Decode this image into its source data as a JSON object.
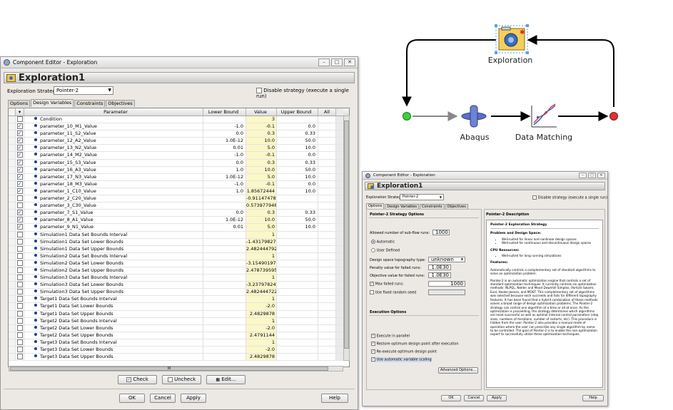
{
  "main": {
    "window_title": "Component Editor - Exploration",
    "header_title": "Exploration1",
    "strategy_label": "Exploration Strategy:",
    "strategy_value": "Pointer-2",
    "disable_label": "Disable strategy (execute a single run)",
    "tabs": [
      "Options",
      "Design Variables",
      "Constraints",
      "Objectives"
    ],
    "columns": [
      "Parameter",
      "Lower Bound",
      "Value",
      "Upper Bound",
      "All"
    ],
    "rows": [
      {
        "checked": false,
        "name": "Condition",
        "lower": "",
        "value": "3",
        "upper": ""
      },
      {
        "checked": true,
        "name": "parameter_10_M1_Value",
        "lower": "-1.0",
        "value": "-0.1",
        "upper": "0.0"
      },
      {
        "checked": true,
        "name": "parameter_11_S2_Value",
        "lower": "0.0",
        "value": "0.3",
        "upper": "0.33"
      },
      {
        "checked": true,
        "name": "parameter_12_A2_Value",
        "lower": "1.0E-12",
        "value": "10.0",
        "upper": "50.0"
      },
      {
        "checked": true,
        "name": "parameter_13_N2_Value",
        "lower": "0.01",
        "value": "5.0",
        "upper": "10.0"
      },
      {
        "checked": true,
        "name": "parameter_14_M2_Value",
        "lower": "-1.0",
        "value": "-0.1",
        "upper": "0.0"
      },
      {
        "checked": true,
        "name": "parameter_15_S3_Value",
        "lower": "0.0",
        "value": "0.3",
        "upper": "0.33"
      },
      {
        "checked": true,
        "name": "parameter_16_A3_Value",
        "lower": "1.0",
        "value": "10.0",
        "upper": "50.0"
      },
      {
        "checked": true,
        "name": "parameter_17_N3_Value",
        "lower": "1.0E-12",
        "value": "5.0",
        "upper": "10.0"
      },
      {
        "checked": true,
        "name": "parameter_18_M3_Value",
        "lower": "-1.0",
        "value": "-0.1",
        "upper": "0.0"
      },
      {
        "checked": true,
        "name": "parameter_1_C10_Value",
        "lower": "1.0",
        "value": "1.85672444",
        "upper": "10.0"
      },
      {
        "checked": false,
        "name": "parameter_2_C20_Value",
        "lower": "",
        "value": "-0.91147478",
        "upper": ""
      },
      {
        "checked": false,
        "name": "parameter_3_C30_Value",
        "lower": "",
        "value": "0.573977948",
        "upper": ""
      },
      {
        "checked": true,
        "name": "parameter_7_S1_Value",
        "lower": "0.0",
        "value": "0.3",
        "upper": "0.33"
      },
      {
        "checked": true,
        "name": "parameter_8_A1_Value",
        "lower": "1.0E-12",
        "value": "10.0",
        "upper": "50.0"
      },
      {
        "checked": true,
        "name": "parameter_9_N1_Value",
        "lower": "0.01",
        "value": "5.0",
        "upper": "10.0"
      },
      {
        "checked": false,
        "name": "Simulation1 Data Set Bounds Interval",
        "lower": "",
        "value": "1",
        "upper": ""
      },
      {
        "checked": false,
        "name": "Simulation1 Data Set Lower Bounds",
        "lower": "",
        "value": "-1.43179827",
        "upper": ""
      },
      {
        "checked": false,
        "name": "Simulation1 Data Set Upper Bounds",
        "lower": "",
        "value": "2.482444792",
        "upper": ""
      },
      {
        "checked": false,
        "name": "Simulation2 Data Set Bounds Interval",
        "lower": "",
        "value": "1",
        "upper": ""
      },
      {
        "checked": false,
        "name": "Simulation2 Data Set Lower Bounds",
        "lower": "",
        "value": "-3.15490197",
        "upper": ""
      },
      {
        "checked": false,
        "name": "Simulation2 Data Set Upper Bounds",
        "lower": "",
        "value": "2.478739595",
        "upper": ""
      },
      {
        "checked": false,
        "name": "Simulation3 Data Set Bounds Interval",
        "lower": "",
        "value": "1",
        "upper": ""
      },
      {
        "checked": false,
        "name": "Simulation3 Data Set Lower Bounds",
        "lower": "",
        "value": "-3.23797824",
        "upper": ""
      },
      {
        "checked": false,
        "name": "Simulation3 Data Set Upper Bounds",
        "lower": "",
        "value": "2.482444722",
        "upper": ""
      },
      {
        "checked": false,
        "name": "Target1 Data Set Bounds Interval",
        "lower": "",
        "value": "1",
        "upper": ""
      },
      {
        "checked": false,
        "name": "Target1 Data Set Lower Bounds",
        "lower": "",
        "value": "-2.0",
        "upper": ""
      },
      {
        "checked": false,
        "name": "Target1 Data Set Upper Bounds",
        "lower": "",
        "value": "2.4829878",
        "upper": ""
      },
      {
        "checked": false,
        "name": "Target2 Data Set Bounds Interval",
        "lower": "",
        "value": "1",
        "upper": ""
      },
      {
        "checked": false,
        "name": "Target2 Data Set Lower Bounds",
        "lower": "",
        "value": "-2.0",
        "upper": ""
      },
      {
        "checked": false,
        "name": "Target2 Data Set Upper Bounds",
        "lower": "",
        "value": "2.4791144",
        "upper": ""
      },
      {
        "checked": false,
        "name": "Target3 Data Set Bounds Interval",
        "lower": "",
        "value": "1",
        "upper": ""
      },
      {
        "checked": false,
        "name": "Target3 Data Set Lower Bounds",
        "lower": "",
        "value": "-2.0",
        "upper": ""
      },
      {
        "checked": false,
        "name": "Target3 Data Set Upper Bounds",
        "lower": "",
        "value": "2.4829878",
        "upper": ""
      }
    ],
    "scroll_marker": "III",
    "check_label": "Check",
    "uncheck_label": "Uncheck",
    "edit_label": "Edit...",
    "ok_label": "OK",
    "cancel_label": "Cancel",
    "apply_label": "Apply",
    "help_label": "Help"
  },
  "workflow": {
    "exploration_label": "Exploration",
    "abaqus_label": "Abaqus",
    "matching_label": "Data Matching"
  },
  "small": {
    "window_title": "Component Editor - Exploration",
    "header_title": "Exploration1",
    "strategy_label": "Exploration Strategy:",
    "strategy_value": "Pointer-2",
    "disable_label": "Disable strategy (execute a single run)",
    "tabs": [
      "Options",
      "Design Variables",
      "Constraints",
      "Objectives"
    ],
    "options_title": "Pointer-2 Strategy Options",
    "subflow_label": "Allowed number of sub-flow runs:",
    "subflow_value": "1000",
    "radio_auto": "Automatic",
    "radio_user": "User Defined",
    "topo_label": "Design space topography type:",
    "topo_value": "unknown",
    "penalty_label": "Penalty value for failed runs:",
    "penalty_value": "1.0E30",
    "objective_label": "Objective value for failed runs:",
    "objective_value": "1.0E30",
    "maxfail_label": "Max failed runs:",
    "maxfail_value": "1000",
    "seed_label": "Use fixed random seed",
    "exec_title": "Execution Options",
    "exec_parallel": "Execute in parallel",
    "restore_label": "Restore optimum design point after execution",
    "reexec_label": "Re-execute optimum design point",
    "autoscale_label": "Use automatic variable scaling",
    "advanced_label": "Advanced Options...",
    "desc_title": "Pointer-2 Description",
    "desc_heading": "Pointer-2 Exploration Strategy",
    "problem_heading": "Problem and Design Space:",
    "problem_items": [
      "Well-suited for linear and nonlinear design spaces",
      "Well-suited for continuous and discontinuous design spaces"
    ],
    "cpu_heading": "CPU Resources:",
    "cpu_items": [
      "Well-suited for long running simulations"
    ],
    "features_heading": "Features:",
    "features_p1": "Automatically controls a complementary set of standard algorithms to solve an optimization problem.",
    "features_p2": "Pointer-2 is an automatic optimization engine that controls a set of standard optimization techniques. It currently controls six optimization methods: NLPQL, Nelder and Mead Downhill Simplex, Particle Swarm, Evol, Hooke-Jeeves, and MOST. This complementary set of algorithms was selected because each succeeds and fails for different topography features. It has been found that a hybrid combination of these methods solves a broad range of design optimization problems. The Pointer-2 strategy can control one algorithm at a time or all at once. As the optimization is proceeding, the strategy determines which algorithms are most successful as well as optimal internal control parameters (step sizes, numbers of iterations, number of restarts, etc). This procedure is hidden from the user. Pointer-2 also provides a manual mode of operation where the user can prescribe any single algorithm by name to be controlled. The goal of Pointer-2 is to enable the non-optimization expert to successfully utilize these optimization techniques.",
    "ok_label": "OK",
    "cancel_label": "Cancel",
    "apply_label": "Apply",
    "help_label": "Help"
  },
  "colors": {
    "value_column": "#fbf7c8",
    "start_node": "#3ccf3c",
    "end_node": "#e23030",
    "abaqus": "#5b6fc4"
  }
}
